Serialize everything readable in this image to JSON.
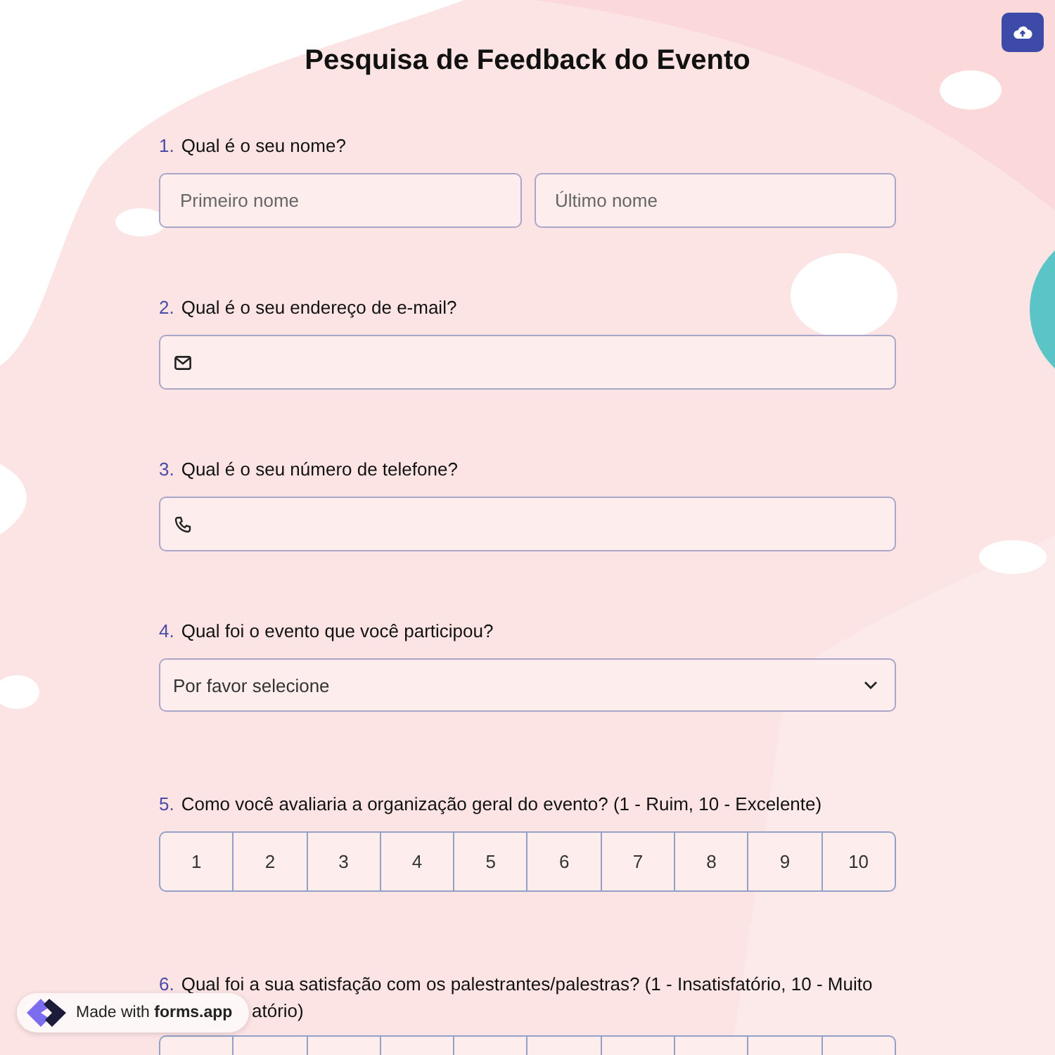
{
  "title": "Pesquisa de Feedback do Evento",
  "questions": [
    {
      "kind": "name",
      "number": "1.",
      "label": "Qual é o seu nome?",
      "fields": [
        {
          "placeholder": "Primeiro nome"
        },
        {
          "placeholder": "Último nome"
        }
      ]
    },
    {
      "kind": "email",
      "number": "2.",
      "label": "Qual é o seu endereço de e-mail?"
    },
    {
      "kind": "phone",
      "number": "3.",
      "label": "Qual é o seu número de telefone?"
    },
    {
      "kind": "select",
      "number": "4.",
      "label": "Qual foi o evento que você participou?",
      "placeholder": "Por favor selecione"
    },
    {
      "kind": "scale",
      "number": "5.",
      "label": "Como você avaliaria a organização geral do evento? (1 - Ruim, 10 - Excelente)",
      "options": [
        "1",
        "2",
        "3",
        "4",
        "5",
        "6",
        "7",
        "8",
        "9",
        "10"
      ]
    },
    {
      "kind": "scale_cut",
      "number": "6.",
      "label": "Qual foi a sua satisfação com os palestrantes/palestras? (1 - Insatisfatório, 10 - Muito",
      "label_rest": "atório)"
    }
  ],
  "badge": {
    "prefix": "Made with",
    "brand": "forms.app"
  }
}
